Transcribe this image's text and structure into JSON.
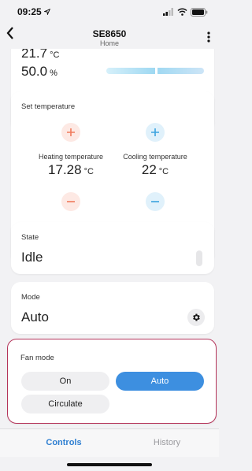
{
  "status": {
    "time": "09:25"
  },
  "nav": {
    "title": "SE8650",
    "subtitle": "Home"
  },
  "readings": {
    "temperature": "21.7",
    "temperature_unit": "°C",
    "humidity": "50.0",
    "humidity_unit": "%",
    "humidity_level_percent": 50
  },
  "set_temperature": {
    "label": "Set temperature",
    "heating_label": "Heating temperature",
    "heating_value": "17.28",
    "heating_unit": "°C",
    "cooling_label": "Cooling temperature",
    "cooling_value": "22",
    "cooling_unit": "°C"
  },
  "state": {
    "label": "State",
    "value": "Idle"
  },
  "mode": {
    "label": "Mode",
    "value": "Auto"
  },
  "fan_mode": {
    "label": "Fan mode",
    "options": [
      "On",
      "Auto",
      "Circulate"
    ],
    "selected": "Auto"
  },
  "tabs": {
    "controls": "Controls",
    "history": "History"
  },
  "colors": {
    "accent": "#3d8fe0",
    "heat": "#f07a5c",
    "cool": "#3aa3df",
    "highlight_border": "#b5345a"
  },
  "icons": [
    "back-chevron-icon",
    "more-vertical-icon",
    "plus-icon",
    "minus-icon",
    "gear-icon",
    "signal-icon",
    "wifi-icon",
    "battery-icon",
    "location-arrow-icon"
  ]
}
